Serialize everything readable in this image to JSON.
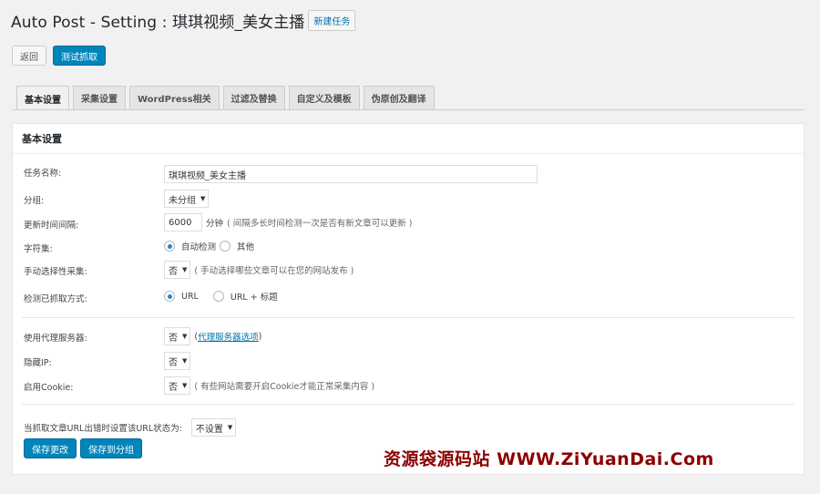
{
  "header": {
    "title": "Auto Post - Setting : 琪琪视频_美女主播",
    "new_task_label": "新建任务"
  },
  "actions": {
    "back_label": "返回",
    "test_fetch_label": "测试抓取"
  },
  "tabs": [
    {
      "label": "基本设置",
      "active": true
    },
    {
      "label": "采集设置"
    },
    {
      "label": "WordPress相关"
    },
    {
      "label": "过滤及替换"
    },
    {
      "label": "自定义及模板"
    },
    {
      "label": "伪原创及翻译"
    }
  ],
  "panel": {
    "title": "基本设置",
    "task_name": {
      "label": "任务名称:",
      "value": "琪琪视频_美女主播"
    },
    "group": {
      "label": "分组:",
      "value": "未分组"
    },
    "interval": {
      "label": "更新时间间隔:",
      "value": "6000",
      "unit": "分钟",
      "note": "( 间隔多长时间检测一次是否有新文章可以更新 )"
    },
    "charset": {
      "label": "字符集:",
      "option_auto": "自动检测",
      "option_other": "其他",
      "selected": "自动检测"
    },
    "manual_select": {
      "label": "手动选择性采集:",
      "value": "否",
      "note": "( 手动选择哪些文章可以在您的网站发布 )"
    },
    "detect_method": {
      "label": "检测已抓取方式:",
      "option_url": "URL",
      "option_url_title": "URL + 标题",
      "selected": "URL"
    },
    "proxy": {
      "label": "使用代理服务器:",
      "value": "否",
      "link_open": "(",
      "link_text": "代理服务器选项",
      "link_close": ")"
    },
    "hide_ip": {
      "label": "隐藏IP:",
      "value": "否"
    },
    "cookie": {
      "label": "启用Cookie:",
      "value": "否",
      "note": "( 有些网站需要开启Cookie才能正常采集内容 )"
    },
    "url_error": {
      "label": "当抓取文章URL出错时设置该URL状态为:",
      "value": "不设置"
    },
    "save_label": "保存更改",
    "save_group_label": "保存到分组"
  },
  "watermark": "资源袋源码站  WWW.ZiYuanDai.Com"
}
